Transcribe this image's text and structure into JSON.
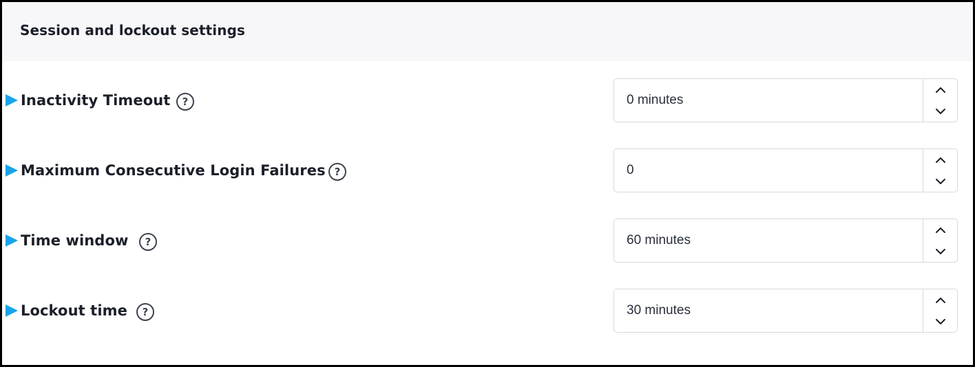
{
  "panel": {
    "title": "Session and lockout settings"
  },
  "settings": [
    {
      "label": "Inactivity Timeout",
      "value": "0 minutes",
      "help_icon": "question-circle-icon"
    },
    {
      "label": "Maximum Consecutive Login Failures",
      "value": "0",
      "help_icon": "question-circle-icon"
    },
    {
      "label": "Time window",
      "value": "60 minutes",
      "help_icon": "question-circle-icon"
    },
    {
      "label": "Lockout time",
      "value": "30 minutes",
      "help_icon": "question-circle-icon"
    }
  ],
  "icons": {
    "help": "?",
    "increment": "chevron-up-icon",
    "decrement": "chevron-down-icon",
    "marker": "triangle-right-icon"
  },
  "colors": {
    "marker": "#1aa3ea",
    "header_bg": "#f7f7f9",
    "text": "#1b1f29",
    "border": "#d5d8de"
  }
}
